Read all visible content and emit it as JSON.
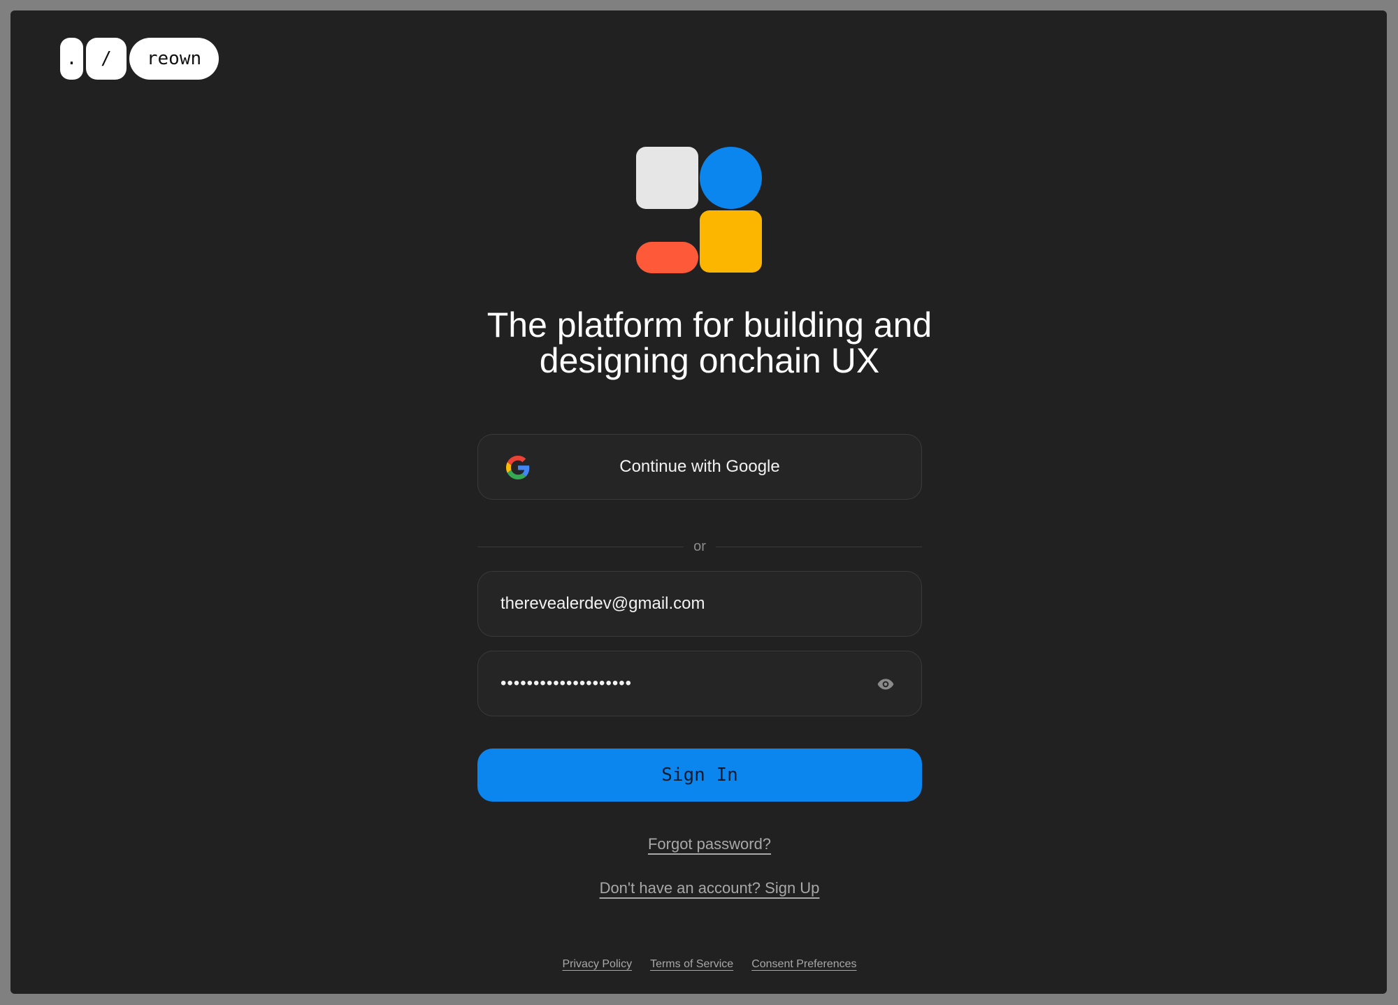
{
  "brand": {
    "dot": ".",
    "slash": "/",
    "name": "reown"
  },
  "hero": {
    "title_line1": "The platform for building and",
    "title_line2": "designing onchain UX",
    "colors": {
      "square": "#e6e6e6",
      "circle": "#0c86ef",
      "pill": "#fe5a3a",
      "rounded": "#fdb600"
    }
  },
  "google_button": {
    "label": "Continue with Google",
    "icon": "google-icon"
  },
  "divider": {
    "label": "or"
  },
  "email_field": {
    "value": "therevealerdev@gmail.com"
  },
  "password_field": {
    "value": "••••••••••••••••••••",
    "toggle_icon": "eye-icon"
  },
  "signin_button": {
    "label": "Sign In",
    "color": "#0c86ef"
  },
  "links": {
    "forgot": "Forgot password?",
    "signup": "Don't have an account? Sign Up"
  },
  "footer": {
    "privacy": "Privacy Policy",
    "terms": "Terms of Service",
    "consent": "Consent Preferences"
  }
}
